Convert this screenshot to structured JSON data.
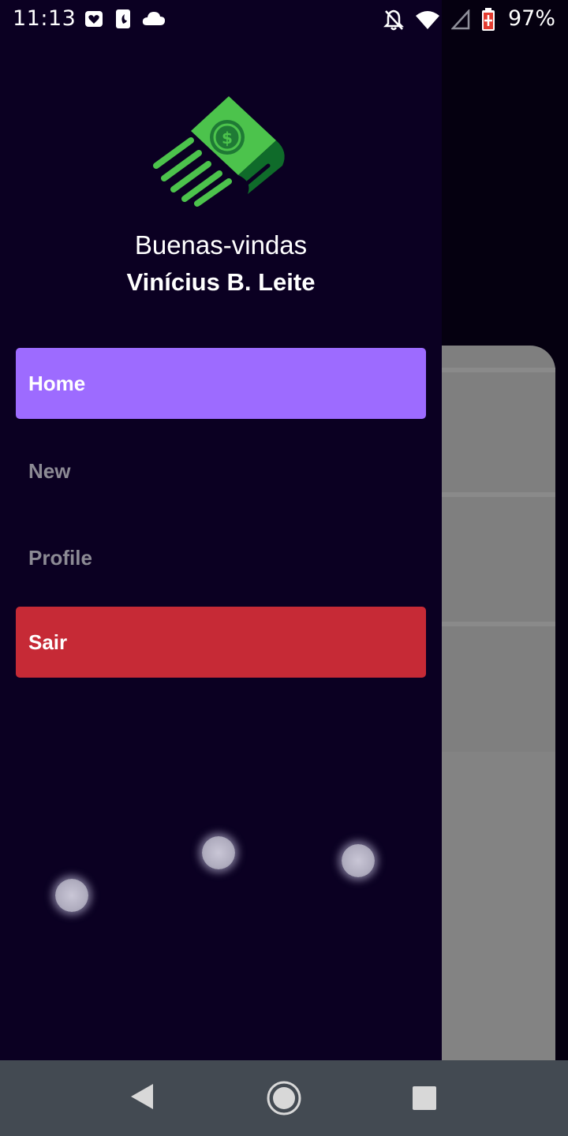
{
  "status_bar": {
    "time": "11:13",
    "battery_percent": "97%",
    "left_icons": [
      "heart-app-icon",
      "clock-app-icon",
      "cloud-icon"
    ],
    "right_icons": [
      "bell-off-icon",
      "wifi-icon",
      "signal-icon",
      "battery-icon"
    ]
  },
  "drawer": {
    "logo": "money-bill-logo",
    "greeting": "Buenas-vindas",
    "user_name": "Vinícius B. Leite",
    "menu": [
      {
        "label": "Home",
        "active": true,
        "bg": "#9d6bff",
        "color": "#ffffff"
      },
      {
        "label": "New",
        "active": false,
        "bg": "transparent",
        "color": "#8c8a94"
      },
      {
        "label": "Profile",
        "active": false,
        "bg": "transparent",
        "color": "#8c8a94"
      },
      {
        "label": "Sair",
        "active": false,
        "bg": "#c62a36",
        "color": "#ffffff"
      }
    ]
  },
  "colors": {
    "drawer_bg": "#0b0022",
    "accent": "#9d6bff",
    "danger": "#c62a36",
    "logo_green": "#4cc34c",
    "logo_dark_green": "#0f6b2a",
    "nav_bar_bg": "#434a52"
  },
  "nav_bar": {
    "icons": [
      "back-triangle-icon",
      "home-circle-icon",
      "recents-square-icon"
    ]
  }
}
